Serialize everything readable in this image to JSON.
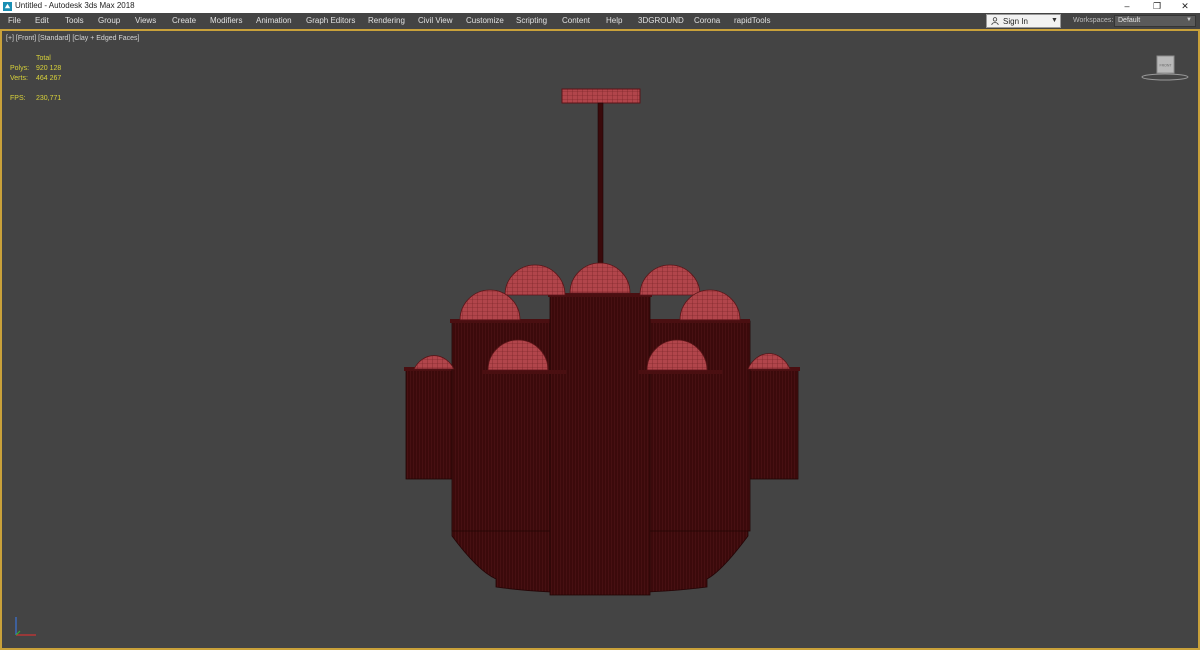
{
  "window": {
    "title": "Untitled - Autodesk 3ds Max 2018",
    "minimize": "–",
    "restore": "❐",
    "close": "✕"
  },
  "menu": [
    "File",
    "Edit",
    "Tools",
    "Group",
    "Views",
    "Create",
    "Modifiers",
    "Animation",
    "Graph Editors",
    "Rendering",
    "Civil View",
    "Customize",
    "Scripting",
    "Content",
    "Help",
    "3DGROUND",
    "Corona",
    "rapidTools"
  ],
  "signin": {
    "label": "Sign In"
  },
  "workspaces": {
    "label": "Workspaces:",
    "value": "Default"
  },
  "viewport": {
    "label": "[+] [Front] [Standard] [Clay + Edged Faces]",
    "stats": {
      "total_header": "Total",
      "polys_label": "Polys:",
      "polys_value": "920 128",
      "verts_label": "Verts:",
      "verts_value": "464 267",
      "fps_label": "FPS:",
      "fps_value": "230,771"
    },
    "viewcube_label": "FRONT"
  },
  "colors": {
    "menubar": "#444444",
    "viewport_bg": "#444444",
    "active_border": "#c9a13a",
    "stats_text": "#d8d23a",
    "mesh_dark": "#3a0a0a",
    "mesh_light": "#b0444a"
  },
  "icons": [
    "app-3dsmax-icon",
    "user-icon",
    "dropdown-caret-icon",
    "viewcube-icon",
    "axis-tripod-icon"
  ]
}
